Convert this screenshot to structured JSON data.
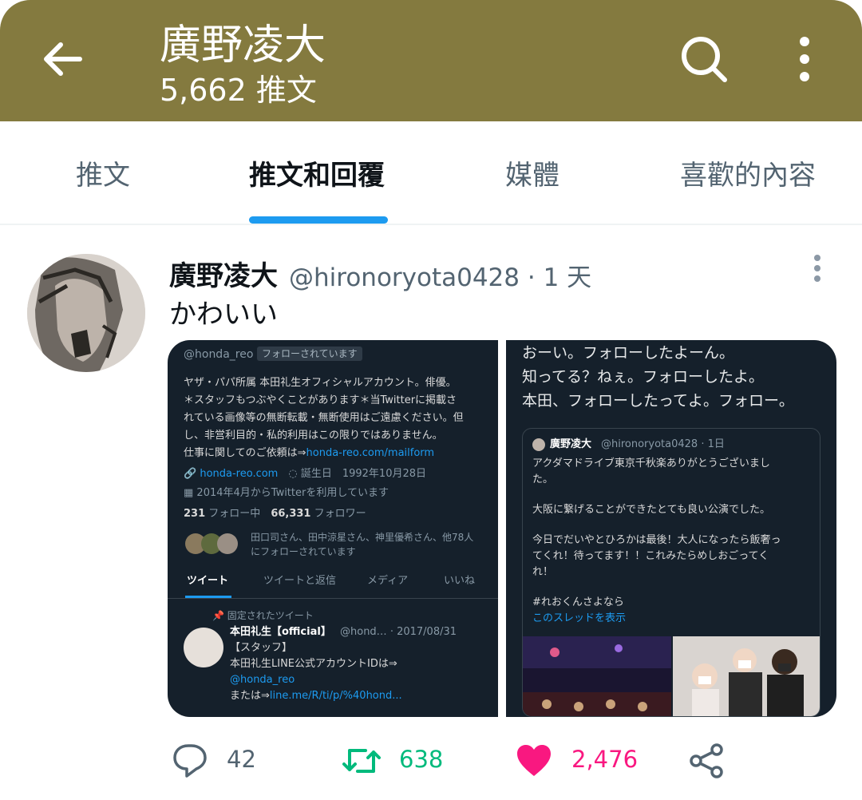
{
  "header": {
    "title": "廣野凌大",
    "tweet_count": "5,662 推文",
    "bg": "#847a3f"
  },
  "tabs": [
    {
      "label": "推文"
    },
    {
      "label": "推文和回覆",
      "active": true
    },
    {
      "label": "媒體"
    },
    {
      "label": "喜歡的內容"
    }
  ],
  "tweet": {
    "name": "廣野凌大",
    "handle": "@hironoryota0428 · 1 天",
    "text": "かわいい",
    "replies": "42",
    "retweets": "638",
    "likes": "2,476"
  },
  "screenshot_left": {
    "handle": "@honda_reo",
    "follow_badge": "フォローされています",
    "bio1": "ヤザ・パパ所属 本田礼生オフィシャルアカウント。俳優。",
    "bio2": "＊スタッフもつぶやくことがあります＊当Twitterに掲載さ",
    "bio3": "れている画像等の無断転載・無断使用はご遠慮ください。但",
    "bio4": "し、非営利目的・私的利用はこの限りではありません。",
    "bio5_prefix": "仕事に関してのご依頼は⇒",
    "bio5_link": "honda-reo.com/mailform",
    "site": "honda-reo.com",
    "birthday": "誕生日　1992年10月28日",
    "joined": "2014年4月からTwitterを利用しています",
    "following_num": "231",
    "following_label": "フォロー中",
    "followers_num": "66,331",
    "followers_label": "フォロワー",
    "followed_by1": "田口司さん、田中涼星さん、神里優希さん、他78人",
    "followed_by2": "にフォローされています",
    "tabs": [
      "ツイート",
      "ツイートと返信",
      "メディア",
      "いいね"
    ],
    "pinned": "固定されたツイート",
    "pinned_name": "本田礼生【official】",
    "pinned_meta": "@hond… · 2017/08/31",
    "pinned_l1": "【スタッフ】",
    "pinned_l2": "本田礼生LINE公式アカウントIDは⇒",
    "pinned_l3": "@honda_reo",
    "pinned_l4_prefix": "または⇒",
    "pinned_l4_link": "line.me/R/ti/p/%40hond..."
  },
  "screenshot_right": {
    "line1": "おーい。フォローしたよーん。",
    "line2": "知ってる？ねぇ。フォローしたよ。",
    "line3": "本田、フォローしたってよ。フォロー。",
    "quote_name": "廣野凌大",
    "quote_meta": "@hironoryota0428 · 1日",
    "q1": "アクダマドライブ東京千秋楽ありがとうございまし",
    "q2": "た。",
    "q3": "大阪に繋げることができたとても良い公演でした。",
    "q4": "今日でだいやとひろかは最後！大人になったら飯奢っ",
    "q5": "てくれ！待ってます！！これみたらめしおごってく",
    "q6": "れ！",
    "q7": "#れおくんさよなら",
    "q8": "このスレッドを表示"
  },
  "colors": {
    "accent": "#1d9bf0",
    "retweet": "#00ba7c",
    "like": "#f91880",
    "muted": "#536471"
  }
}
